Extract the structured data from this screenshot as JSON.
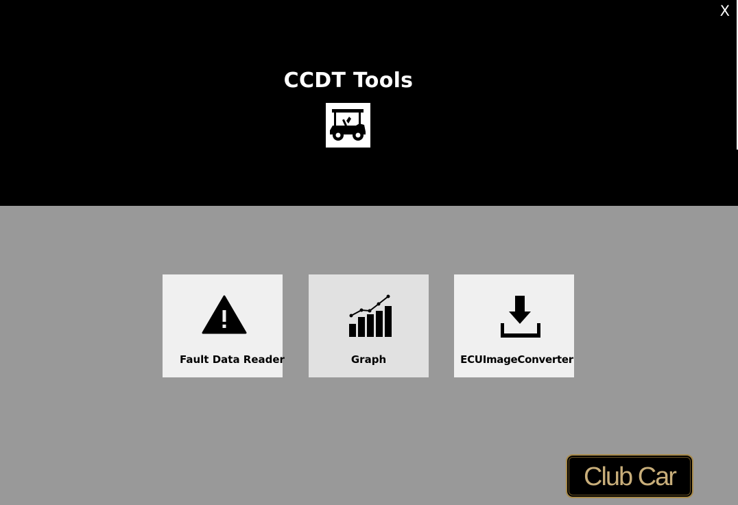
{
  "window": {
    "close_label": "X",
    "title": "CCDT Tools",
    "app_icon": "golf-cart-icon"
  },
  "tools": [
    {
      "label": "Fault Data Reader",
      "icon": "warning-icon",
      "selected": false
    },
    {
      "label": "Graph",
      "icon": "chart-icon",
      "selected": true
    },
    {
      "label": "ECUImageConverter",
      "icon": "download-icon",
      "selected": false
    }
  ],
  "brand": {
    "logo_text": "Club Car",
    "text_color": "#c8ae7a",
    "border_color": "#a88a4a"
  },
  "colors": {
    "header_bg": "#000000",
    "body_bg": "#999999",
    "tile_bg": "#f0f0f0",
    "tile_selected_bg": "#e1e1e1"
  }
}
